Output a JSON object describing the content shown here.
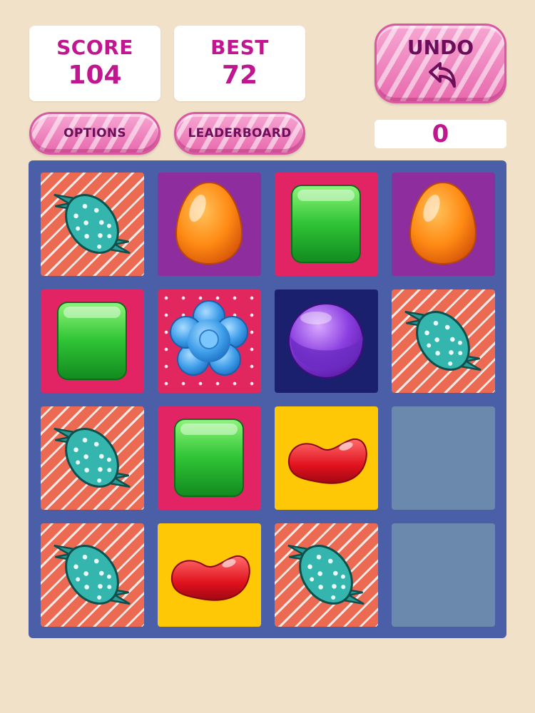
{
  "scoreboard": {
    "score_label": "SCORE",
    "score_value": "104",
    "best_label": "BEST",
    "best_value": "72"
  },
  "controls": {
    "undo_label": "UNDO",
    "options_label": "OPTIONS",
    "leaderboard_label": "LEADERBOARD",
    "undo_count": "0"
  },
  "board": {
    "size": 4,
    "tiles": [
      [
        "wrapped-candy",
        "orange-jellybean",
        "green-gummy",
        "orange-jellybean"
      ],
      [
        "green-gummy",
        "blue-flower-candy",
        "purple-lollipop",
        "wrapped-candy"
      ],
      [
        "wrapped-candy",
        "green-gummy",
        "red-jellybean",
        "empty"
      ],
      [
        "wrapped-candy",
        "red-jellybean",
        "wrapped-candy",
        "empty"
      ]
    ]
  }
}
